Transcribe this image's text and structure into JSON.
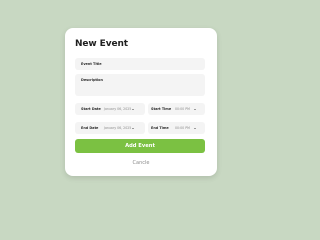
{
  "dialog": {
    "title": "New Event",
    "fields": {
      "event_title": {
        "placeholder": "Event Title"
      },
      "description": {
        "placeholder": "Description"
      },
      "start_date": {
        "label": "Start Date",
        "value": "January 06, 2025"
      },
      "start_time": {
        "label": "Start Time",
        "value": "00:00 PM"
      },
      "end_date": {
        "label": "End Date",
        "value": "January 06, 2025"
      },
      "end_time": {
        "label": "End Time",
        "value": "00:00 PM"
      }
    },
    "buttons": {
      "add": "Add Event",
      "cancel": "Cancle"
    }
  },
  "colors": {
    "background": "#c8d8c2",
    "accent": "#7bc142"
  }
}
